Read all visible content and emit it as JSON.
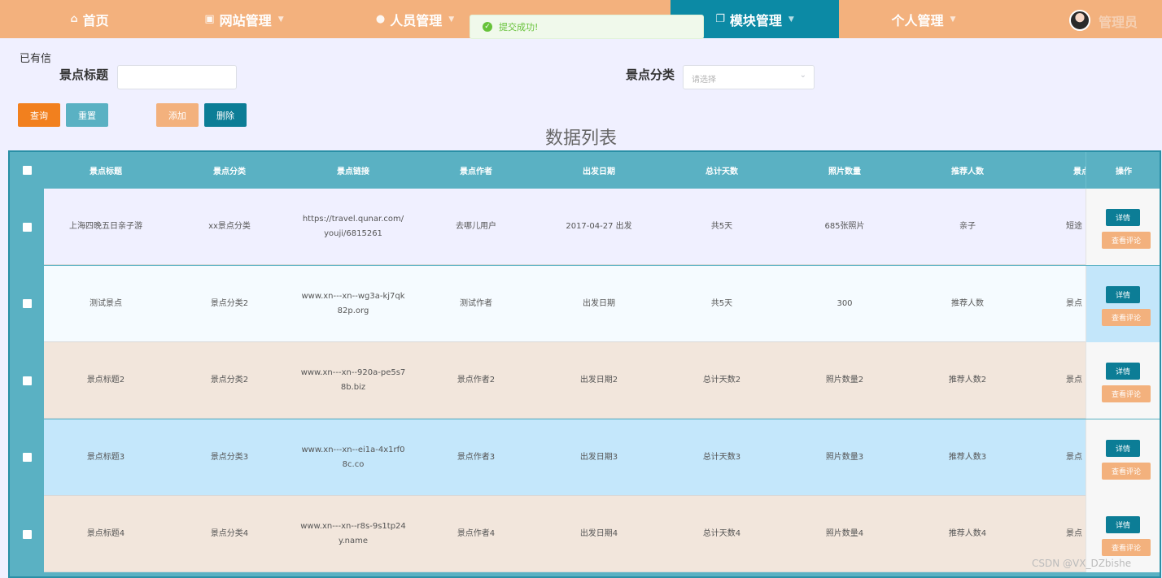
{
  "nav": {
    "items": [
      {
        "label": "首页",
        "icon": "home-icon"
      },
      {
        "label": "网站管理",
        "icon": "monitor-icon"
      },
      {
        "label": "人员管理",
        "icon": "user-icon"
      },
      {
        "label": "模块管理",
        "icon": "module-icon",
        "active": true
      },
      {
        "label": "个人管理",
        "icon": ""
      }
    ],
    "admin_name": "管理员"
  },
  "toast": {
    "message": "提交成功!"
  },
  "search": {
    "corner_text": "已有信",
    "title_label": "景点标题",
    "title_value": "",
    "category_label": "景点分类",
    "category_placeholder": "请选择"
  },
  "buttons": {
    "query": "查询",
    "reset": "重置",
    "add": "添加",
    "delete": "删除"
  },
  "list_title": "数据列表",
  "table": {
    "headers": [
      "景点标题",
      "景点分类",
      "景点链接",
      "景点作者",
      "出发日期",
      "总计天数",
      "照片数量",
      "推荐人数",
      "景点"
    ],
    "op_header": "操作",
    "detail_label": "详情",
    "comment_label": "查看评论",
    "rows": [
      [
        "上海四晚五日亲子游",
        "xx景点分类",
        "https://travel.qunar.com/youji/6815261",
        "去哪儿用户",
        "2017-04-27 出发",
        "共5天",
        "685张照片",
        "亲子",
        "短途"
      ],
      [
        "测试景点",
        "景点分类2",
        "www.xn---xn--wg3a-kj7qk82p.org",
        "测试作者",
        "出发日期",
        "共5天",
        "300",
        "推荐人数",
        "景点"
      ],
      [
        "景点标题2",
        "景点分类2",
        "www.xn---xn--920a-pe5s78b.biz",
        "景点作者2",
        "出发日期2",
        "总计天数2",
        "照片数量2",
        "推荐人数2",
        "景点"
      ],
      [
        "景点标题3",
        "景点分类3",
        "www.xn---xn--ei1a-4x1rf08c.co",
        "景点作者3",
        "出发日期3",
        "总计天数3",
        "照片数量3",
        "推荐人数3",
        "景点"
      ],
      [
        "景点标题4",
        "景点分类4",
        "www.xn---xn--r8s-9s1tp24y.name",
        "景点作者4",
        "出发日期4",
        "总计天数4",
        "照片数量4",
        "推荐人数4",
        "景点"
      ]
    ],
    "row_colors": [
      "#f0f0ff",
      "#f5fbff",
      "#f2e6dc",
      "#c4e7fb",
      "#f2e6dc"
    ]
  },
  "watermark": "CSDN @VX_DZbishe",
  "colors": {
    "nav_bg": "#f3b17d",
    "nav_active": "#0c8aa5",
    "header_bg": "#5ab1c3",
    "query_btn": "#f2801e",
    "reset_btn": "#5ab1c3",
    "add_btn": "#f3b17d",
    "delete_btn": "#0c7d96",
    "detail_btn": "#0c7d96",
    "comment_btn": "#f3b17d"
  }
}
